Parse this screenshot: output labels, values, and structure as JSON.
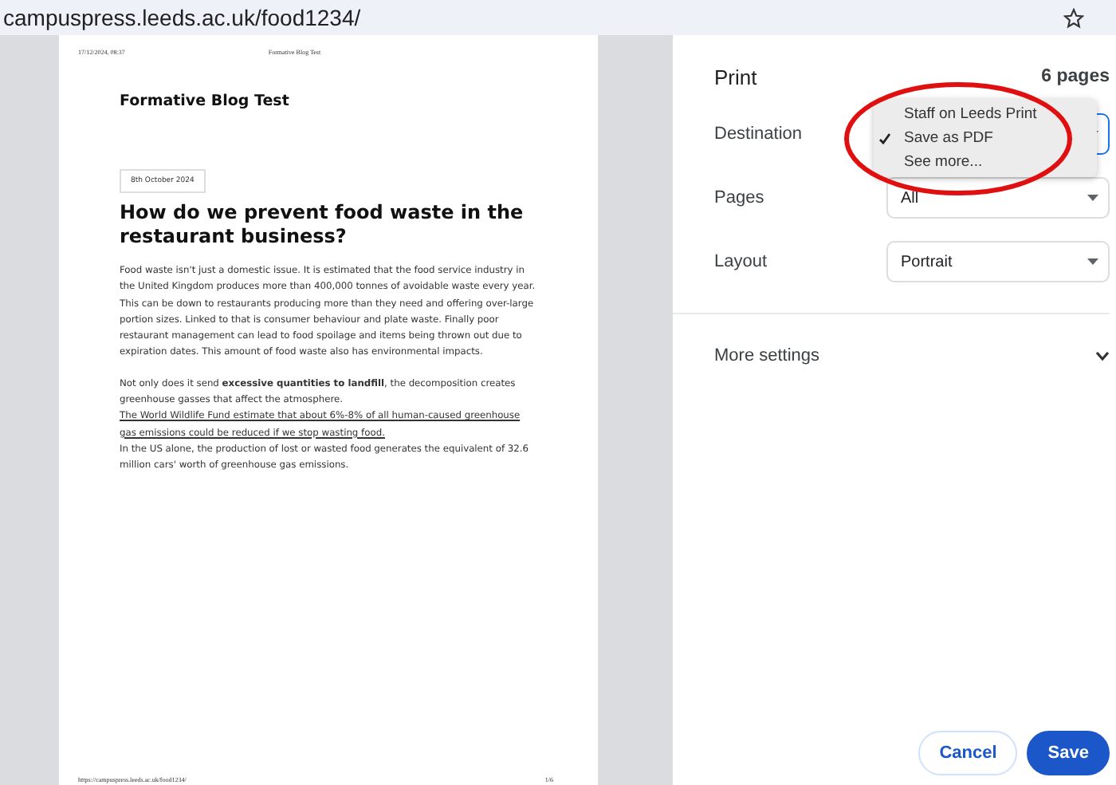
{
  "address_bar": {
    "url": "campuspress.leeds.ac.uk/food1234/"
  },
  "preview": {
    "header_left": "17/12/2024, 08:37",
    "header_center": "Formative Blog Test",
    "site_title": "Formative Blog Test",
    "date": "8th October 2024",
    "heading": "How do we prevent food waste in the restaurant business?",
    "paragraphs": [
      {
        "text": "Food waste isn't just a domestic issue. It is estimated that the food service industry in the United Kingdom produces more than 400,000 tonnes of avoidable waste every year. This can be down to restaurants producing more than they need and offering over-large portion sizes. Linked to that is consumer behaviour and plate waste. Finally poor restaurant management can lead to food spoilage and items being thrown out due to expiration dates. This amount of food waste also has environmental impacts."
      },
      {
        "before": "Not only does it send **excessive quantities to landfill**, the decomposition creates greenhouse gasses that affect the atmosphere. ",
        "link": "The World Wildlife Fund estimate that about 6%-8% of all human-caused greenhouse gas emissions could be reduced if we stop wasting food.",
        "after": " In the US alone, the production of lost or wasted food generates the equivalent of 32.6 million cars' worth of greenhouse gas emissions."
      }
    ],
    "footer_left": "https://campuspress.leeds.ac.uk/food1234/",
    "footer_right": "1/6"
  },
  "print_panel": {
    "title": "Print",
    "page_count": "6 pages",
    "settings": [
      {
        "label": "Destination"
      },
      {
        "label": "Pages",
        "value": "All"
      },
      {
        "label": "Layout",
        "value": "Portrait"
      }
    ],
    "destination_menu": [
      {
        "label": "Staff on Leeds Print",
        "selected": false
      },
      {
        "label": "Save as PDF",
        "selected": true
      },
      {
        "label": "See more...",
        "selected": false
      }
    ],
    "more_settings": {
      "label": "More settings",
      "expanded": false
    },
    "buttons": [
      {
        "label": "Cancel",
        "kind": "secondary"
      },
      {
        "label": "Save",
        "kind": "primary"
      }
    ]
  }
}
